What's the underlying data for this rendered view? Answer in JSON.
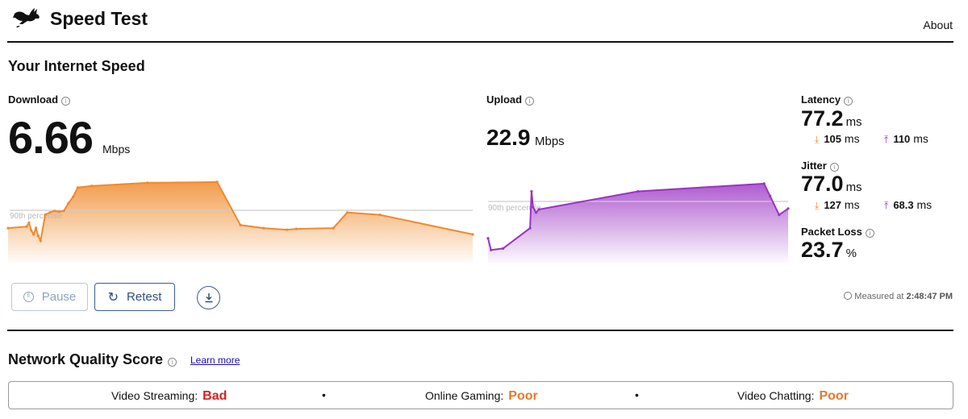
{
  "header": {
    "app_title": "Speed Test",
    "logo_icon": "running-rabbit-icon",
    "about_link": "About"
  },
  "speed": {
    "section_title": "Your Internet Speed",
    "download": {
      "label": "Download",
      "value": "6.66",
      "unit": "Mbps"
    },
    "upload": {
      "label": "Upload",
      "value": "22.9",
      "unit": "Mbps"
    },
    "latency": {
      "label": "Latency",
      "value": "77.2",
      "unit": "ms",
      "down_value": "105",
      "up_value": "110",
      "sub_unit": "ms"
    },
    "jitter": {
      "label": "Jitter",
      "value": "77.0",
      "unit": "ms",
      "down_value": "127",
      "up_value": "68.3",
      "sub_unit": "ms"
    },
    "packet_loss": {
      "label": "Packet Loss",
      "value": "23.7",
      "unit": "%"
    },
    "percentile_label": "90th percentile"
  },
  "controls": {
    "pause_label": "Pause",
    "retest_label": "Retest",
    "measured_prefix": "Measured at",
    "measured_time": "2:48:47 PM"
  },
  "network_quality": {
    "title": "Network Quality Score",
    "learn_more": "Learn more",
    "items": [
      {
        "label": "Video Streaming:",
        "value": "Bad",
        "color": "#d42020"
      },
      {
        "label": "Online Gaming:",
        "value": "Poor",
        "color": "#e8782a"
      },
      {
        "label": "Video Chatting:",
        "value": "Poor",
        "color": "#e8782a"
      }
    ],
    "separator": "•"
  },
  "colors": {
    "download": "#f08a2c",
    "upload": "#9b32c4",
    "button_border": "#3d5f8c"
  },
  "chart_data": [
    {
      "type": "area",
      "title": "Download",
      "x": [
        0,
        0.04,
        0.045,
        0.05,
        0.055,
        0.06,
        0.065,
        0.07,
        0.08,
        0.09,
        0.1,
        0.11,
        0.12,
        0.13,
        0.14,
        0.15,
        0.18,
        0.3,
        0.45,
        0.5,
        0.55,
        0.6,
        0.62,
        0.7,
        0.73,
        0.8,
        1.0
      ],
      "y": [
        0.38,
        0.4,
        0.45,
        0.35,
        0.3,
        0.38,
        0.28,
        0.22,
        0.55,
        0.58,
        0.6,
        0.59,
        0.6,
        0.7,
        0.78,
        0.9,
        0.92,
        0.96,
        0.97,
        0.42,
        0.38,
        0.36,
        0.37,
        0.38,
        0.58,
        0.55,
        0.3
      ],
      "threshold_label": "90th percentile",
      "threshold": 0.7
    },
    {
      "type": "area",
      "title": "Upload",
      "x": [
        0,
        0.01,
        0.05,
        0.14,
        0.145,
        0.15,
        0.16,
        0.17,
        0.5,
        0.92,
        0.94,
        0.97,
        1.0
      ],
      "y": [
        0.25,
        0.1,
        0.12,
        0.38,
        0.85,
        0.65,
        0.58,
        0.62,
        0.85,
        0.95,
        0.79,
        0.55,
        0.63
      ],
      "threshold_label": "90th percentile",
      "threshold": 0.78
    }
  ]
}
